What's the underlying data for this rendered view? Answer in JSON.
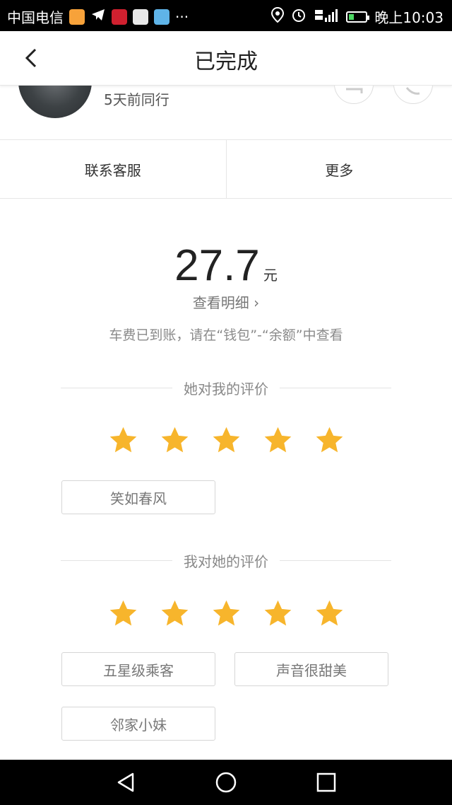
{
  "status_bar": {
    "carrier": "中国电信",
    "more_indicator": "···",
    "time": "晚上10:03",
    "battery_level": 0.3,
    "icons": [
      "didi-app-icon",
      "telegram-icon",
      "huawei-icon",
      "gallery-icon",
      "video-icon",
      "location-icon",
      "alarm-icon",
      "signal-icon",
      "battery-icon"
    ]
  },
  "header": {
    "title": "已完成",
    "back_icon": "chevron-left-icon"
  },
  "driver": {
    "trip_info": "5天前同行"
  },
  "actions": {
    "service": "联系客服",
    "more": "更多"
  },
  "fare": {
    "amount": "27.7",
    "unit": "元",
    "detail_link": "查看明细 ›",
    "notice": "车费已到账，请在“钱包”-“余额”中查看"
  },
  "rating_received": {
    "heading": "她对我的评价",
    "stars": 5,
    "max_stars": 5,
    "tags": [
      "笑如春风"
    ]
  },
  "rating_given": {
    "heading": "我对她的评价",
    "stars": 5,
    "max_stars": 5,
    "tags": [
      "五星级乘客",
      "声音很甜美",
      "邻家小妹"
    ]
  },
  "colors": {
    "star": "#f7b52c",
    "status_bar": "#000000",
    "nav_bar": "#000000"
  }
}
